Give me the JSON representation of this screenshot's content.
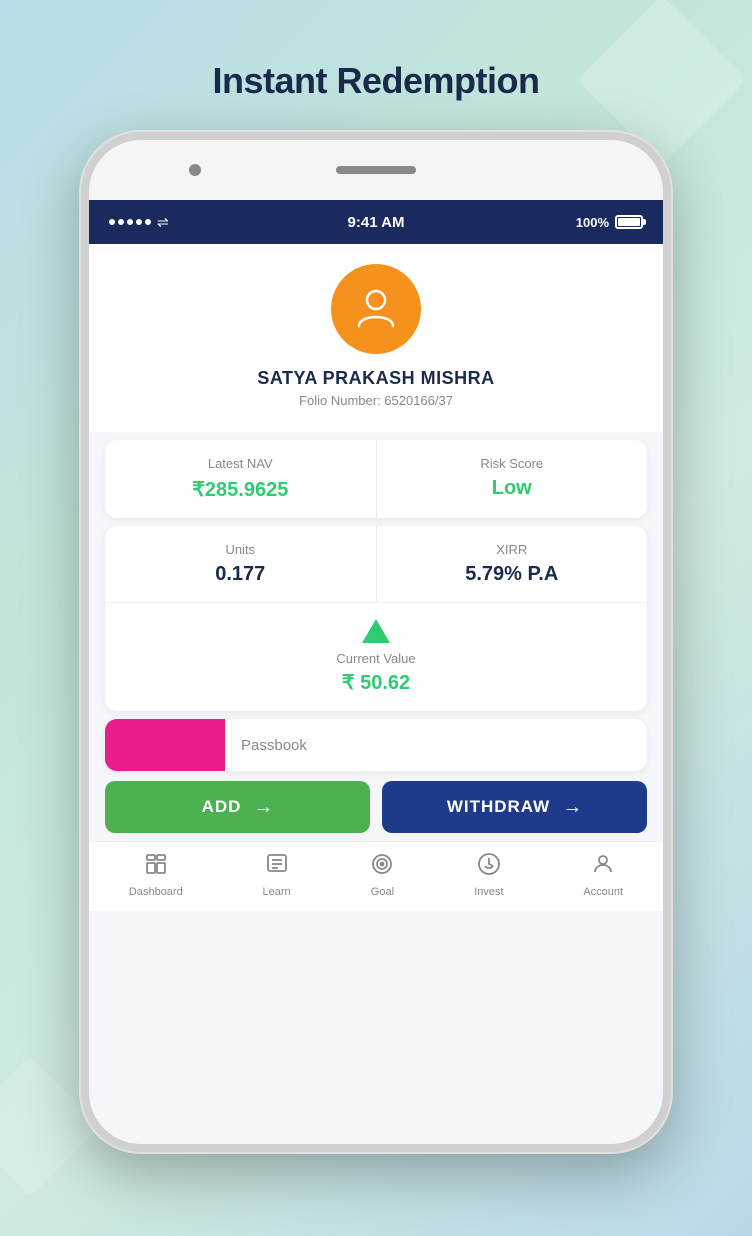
{
  "page": {
    "title": "Instant Redemption",
    "background_note": "gradient teal/mint"
  },
  "status_bar": {
    "time": "9:41 AM",
    "battery": "100%",
    "battery_full": true
  },
  "profile": {
    "name": "SATYA PRAKASH MISHRA",
    "folio_label": "Folio Number: 6520166/37"
  },
  "stats": {
    "nav_label": "Latest NAV",
    "nav_value": "₹285.9625",
    "risk_label": "Risk Score",
    "risk_value": "Low"
  },
  "investment": {
    "units_label": "Units",
    "units_value": "0.177",
    "xirr_label": "XIRR",
    "xirr_value": "5.79% P.A",
    "current_value_label": "Current Value",
    "current_value": "₹ 50.62"
  },
  "passbook": {
    "label": "Passbook"
  },
  "buttons": {
    "add_label": "ADD",
    "withdraw_label": "WITHDRAW"
  },
  "bottom_nav": {
    "items": [
      {
        "icon": "dashboard",
        "label": "Dashboard"
      },
      {
        "icon": "learn",
        "label": "Learn"
      },
      {
        "icon": "goal",
        "label": "Goal"
      },
      {
        "icon": "invest",
        "label": "Invest"
      },
      {
        "icon": "account",
        "label": "Account"
      }
    ]
  }
}
